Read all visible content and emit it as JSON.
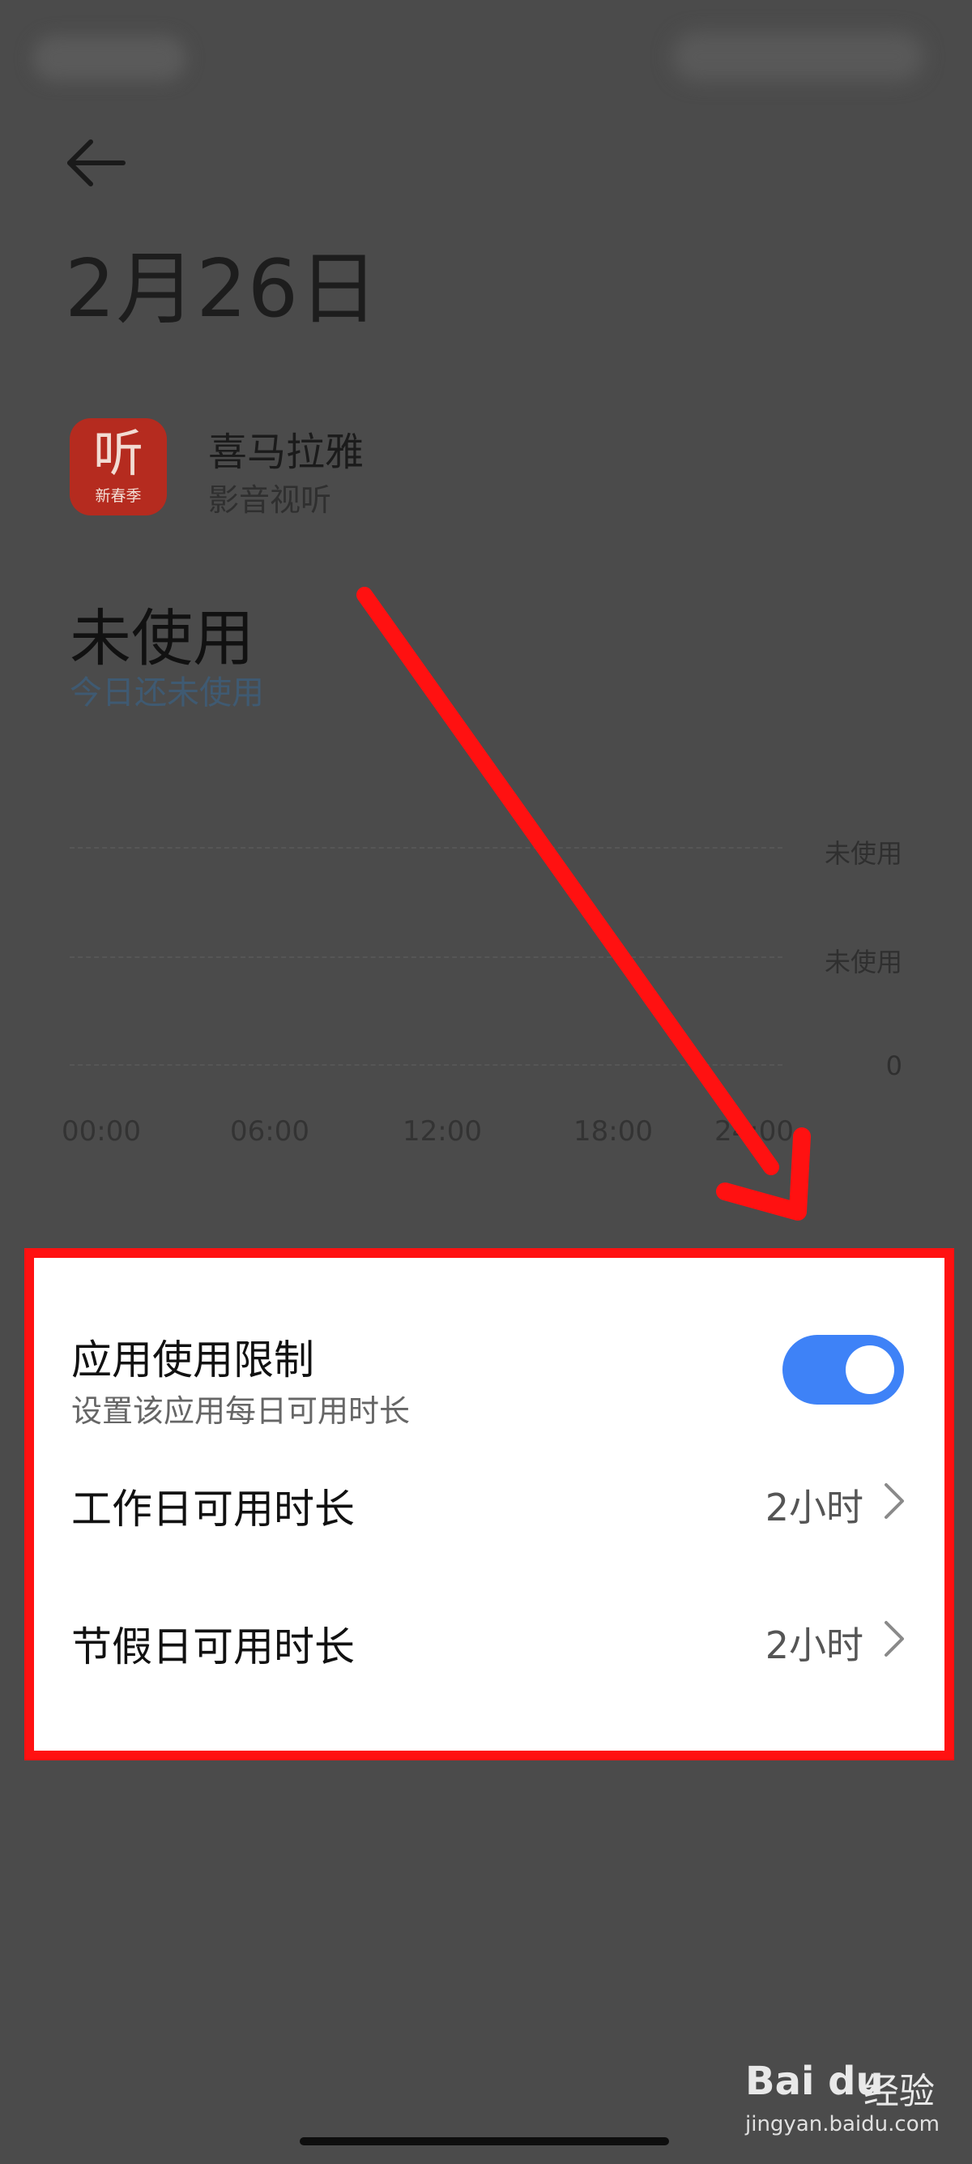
{
  "header": {
    "title": "2月26日"
  },
  "app": {
    "name": "喜马拉雅",
    "category": "影音视听",
    "icon_glyph": "听",
    "icon_sub": "新春季",
    "icon_color": "#b52b1f"
  },
  "usage": {
    "state": "未使用",
    "subtitle": "今日还未使用"
  },
  "chart_data": {
    "type": "bar",
    "x": [
      "00:00",
      "06:00",
      "12:00",
      "18:00",
      "24:00"
    ],
    "y_ticks": [
      "未使用",
      "未使用",
      "0"
    ],
    "series": []
  },
  "settings": {
    "limit_title": "应用使用限制",
    "limit_desc": "设置该应用每日可用时长",
    "limit_enabled": true,
    "workday_title": "工作日可用时长",
    "workday_value": "2小时",
    "holiday_title": "节假日可用时长",
    "holiday_value": "2小时"
  },
  "watermark": {
    "brand": "Bai du",
    "suffix": "经验",
    "url": "jingyan.baidu.com"
  },
  "colors": {
    "accent": "#3e82f7",
    "highlight": "#ff1111",
    "overlay": "#4b4b4b"
  }
}
